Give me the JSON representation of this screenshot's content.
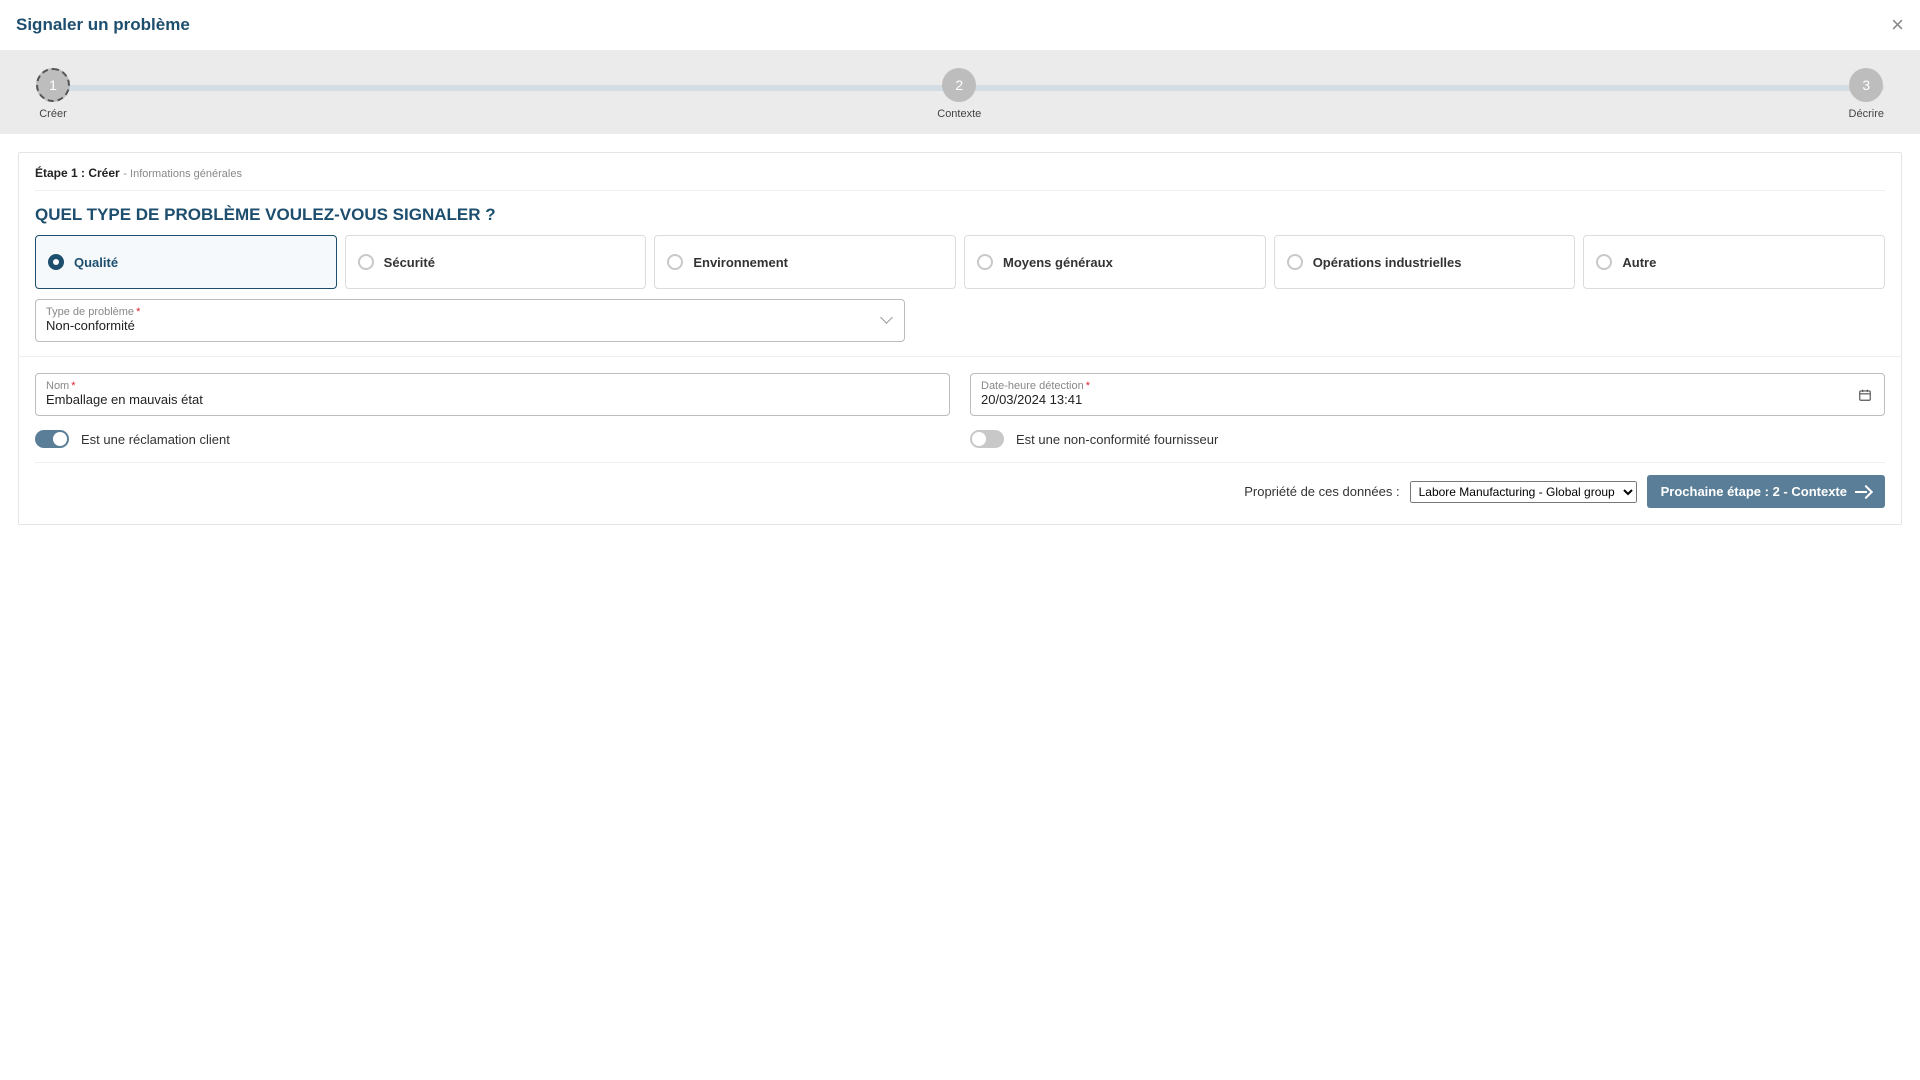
{
  "header": {
    "title": "Signaler un problème"
  },
  "stepper": {
    "steps": [
      {
        "num": "1",
        "label": "Créer"
      },
      {
        "num": "2",
        "label": "Contexte"
      },
      {
        "num": "3",
        "label": "Décrire"
      }
    ]
  },
  "card": {
    "step_title": "Étape 1 : Créer",
    "step_sub": " - Informations générales",
    "question": "Quel type de problème voulez-vous signaler ?"
  },
  "types": [
    {
      "label": "Qualité"
    },
    {
      "label": "Sécurité"
    },
    {
      "label": "Environnement"
    },
    {
      "label": "Moyens généraux"
    },
    {
      "label": "Opérations industrielles"
    },
    {
      "label": "Autre"
    }
  ],
  "subtype": {
    "label": "Type de problème",
    "value": "Non-conformité"
  },
  "name_field": {
    "label": "Nom",
    "value": "Emballage en mauvais état"
  },
  "date_field": {
    "label": "Date-heure détection",
    "value": "20/03/2024 13:41"
  },
  "toggles": {
    "client": "Est une réclamation client",
    "supplier": "Est une non-conformité fournisseur"
  },
  "footer": {
    "owner_label": "Propriété de ces données :",
    "owner_value": "Labore Manufacturing - Global group",
    "next_label": "Prochaine étape : 2 - Contexte"
  }
}
